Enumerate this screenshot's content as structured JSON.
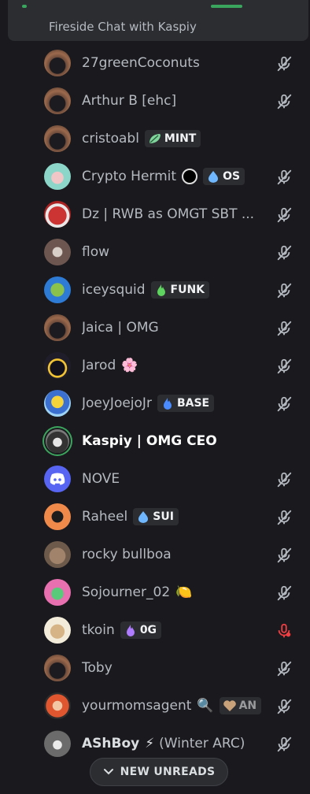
{
  "channel": {
    "title": "Fireside Chat with Kaspiy"
  },
  "members": [
    {
      "name": "27greenCoconuts",
      "avatar": "hooded-figure-avatar",
      "muted": true
    },
    {
      "name": "Arthur B [ehc]",
      "avatar": "hooded-figure-avatar",
      "muted": true
    },
    {
      "name": "cristoabl",
      "avatar": "hooded-figure-avatar",
      "tag": {
        "label": "MINT",
        "icon": "leaf-icon",
        "color": "#7fd59b"
      },
      "muted": false
    },
    {
      "name": "Crypto Hermit",
      "avatar": "pixel-character-avatar",
      "extra_icon": "black-circle-emoji",
      "tag": {
        "label": "OS",
        "icon": "water-drop-icon",
        "color": "#6fb8ff"
      },
      "muted": true
    },
    {
      "name": "Dz | RWB as OMGT SBT ...",
      "avatar": "red-robot-avatar",
      "muted": true
    },
    {
      "name": "flow",
      "avatar": "grey-creature-avatar",
      "muted": true
    },
    {
      "name": "iceysquid",
      "avatar": "green-squid-avatar",
      "tag": {
        "label": "FUNK",
        "icon": "green-flame-icon",
        "color": "#5fd35f"
      },
      "muted": true
    },
    {
      "name": "Jaica | OMG",
      "avatar": "hooded-figure-avatar",
      "muted": true
    },
    {
      "name": "Jarod",
      "avatar": "hooded-pixel-avatar",
      "emoji": "🌸",
      "muted": true
    },
    {
      "name": "JoeyJoejoJr",
      "avatar": "cartoon-character-avatar",
      "tag": {
        "label": "BASE",
        "icon": "blue-flame-icon",
        "color": "#4a8cff"
      },
      "muted": true
    },
    {
      "name": "Kaspiy | OMG CEO",
      "avatar": "speaking-character-avatar",
      "speaking": true,
      "muted": false
    },
    {
      "name": "NOVE",
      "avatar": "discord-logo-avatar",
      "muted": true
    },
    {
      "name": "Raheel",
      "avatar": "orange-cat-avatar",
      "tag": {
        "label": "SUI",
        "icon": "water-drop-icon",
        "color": "#6fb8ff"
      },
      "muted": true
    },
    {
      "name": "rocky bullboa",
      "avatar": "dog-face-avatar",
      "muted": true
    },
    {
      "name": "Sojourner_02",
      "avatar": "pink-fish-avatar",
      "emoji": "🍋",
      "muted": true
    },
    {
      "name": "tkoin",
      "avatar": "lion-face-avatar",
      "tag": {
        "label": "0G",
        "icon": "purple-flame-icon",
        "color": "#b07cff"
      },
      "muted": false,
      "mic_alert": true
    },
    {
      "name": "Toby",
      "avatar": "hooded-figure-avatar",
      "muted": true
    },
    {
      "name": "yourmomsagent",
      "avatar": "red-hair-avatar",
      "emoji": "🔍",
      "tag": {
        "label": "AN",
        "icon": "heart-icon",
        "color": "#c9a27a"
      },
      "muted": true
    },
    {
      "name": "AShBoy",
      "avatar": "hooded-grey-avatar",
      "name_suffix": "(Winter ARC)",
      "emoji": "⚡",
      "muted": true
    }
  ],
  "new_unreads": {
    "label": "NEW UNREADS",
    "icon": "chevron-down-icon"
  },
  "colors": {
    "background": "#1a1a1e",
    "muted_icon": "#b5bac1",
    "mic_alert": "#f23f43",
    "speaking_ring": "#3ba55d"
  }
}
